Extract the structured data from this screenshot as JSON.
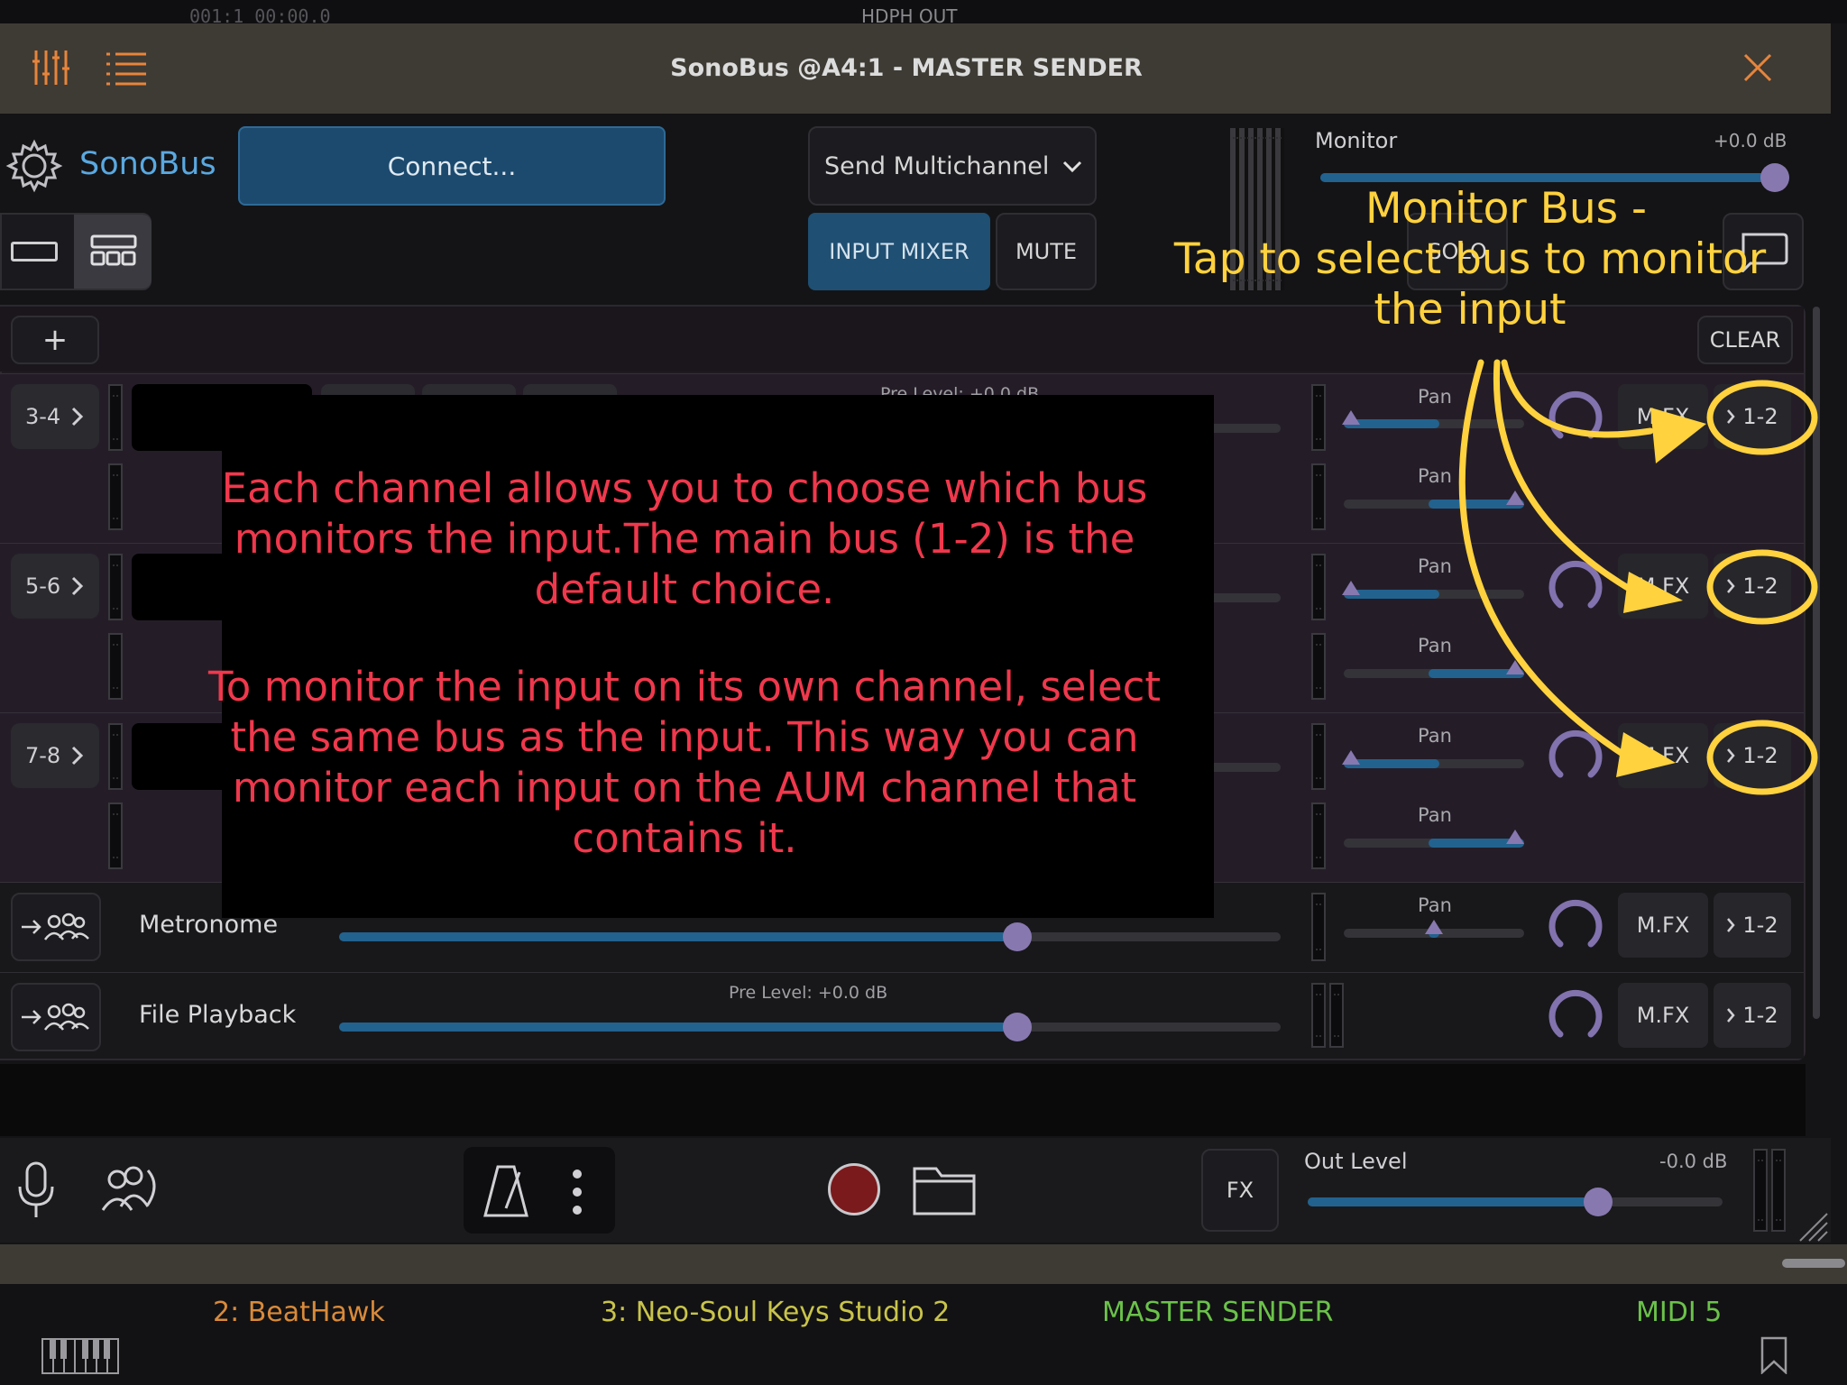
{
  "top_bar": {
    "counter": "001:1  00:00.0",
    "output": "HDPH OUT"
  },
  "title_bar": {
    "title": "SonoBus @A4:1 - MASTER SENDER"
  },
  "header": {
    "app_name": "SonoBus",
    "connect_label": "Connect...",
    "send_mode": "Send Multichannel",
    "input_mixer_label": "INPUT MIXER",
    "mute_label": "MUTE",
    "solo_label": "SOLO",
    "monitor_label": "Monitor",
    "monitor_db": "+0.0 dB",
    "monitor_level": 0.97
  },
  "input_panel": {
    "add_label": "+",
    "clear_label": "CLEAR"
  },
  "channels": [
    {
      "name": "3-4",
      "pre_level": "Pre Level: +0.0 dB",
      "pan_label": "Pan",
      "mfx": "M.FX",
      "bus": "1-2"
    },
    {
      "name": "5-6",
      "pan_label": "Pan",
      "mfx": "M.FX",
      "bus": "1-2"
    },
    {
      "name": "7-8",
      "pan_label": "Pan",
      "mfx": "M.FX",
      "bus": "1-2"
    }
  ],
  "metronome": {
    "label": "Metronome",
    "pan_label": "Pan",
    "mfx": "M.FX",
    "bus": "1-2",
    "level": 0.72
  },
  "file_playback": {
    "label": "File Playback",
    "pre_level": "Pre Level: +0.0 dB",
    "mfx": "M.FX",
    "bus": "1-2",
    "level": 0.72
  },
  "footer": {
    "fx_label": "FX",
    "out_level_label": "Out Level",
    "out_level_db": "-0.0 dB",
    "out_level": 0.7
  },
  "host_tabs": [
    {
      "label": "2: BeatHawk",
      "color": "#d98a3a"
    },
    {
      "label": "3: Neo-Soul Keys Studio 2",
      "color": "#c9c44a"
    },
    {
      "label": "MASTER SENDER",
      "color": "#6bc24a"
    },
    {
      "label": "MIDI 5",
      "color": "#6bc24a"
    }
  ],
  "annotations": {
    "overlay_text_1": "Each channel allows you to choose which bus monitors the input.The main bus (1-2) is the default choice.",
    "overlay_text_2": "To monitor the input on its own channel, select the same bus as the input. This way you can monitor each input on the AUM channel that contains it.",
    "callout_line1": "Monitor Bus -",
    "callout_line2": "Tap to select bus to monitor the input"
  },
  "colors": {
    "accent_blue": "#22628f",
    "orange": "#e8843a",
    "annotation_red": "#f0384c",
    "annotation_yellow": "#ffd23e",
    "thumb": "#8878b0"
  }
}
